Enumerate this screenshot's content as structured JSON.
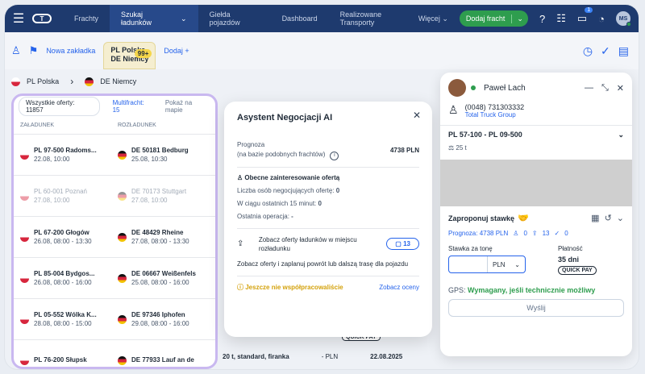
{
  "nav": {
    "logo": "T",
    "items": [
      "Frachty",
      "Szukaj ładunków",
      "Giełda pojazdów",
      "Dashboard",
      "Realizowane Transporty"
    ],
    "more": "Więcej",
    "add_freight": "Dodaj fracht",
    "chat_badge": "1",
    "avatar": "MS"
  },
  "tabs": {
    "new_tab": "Nowa zakładka",
    "active_tab_line1": "PL Polska",
    "active_tab_line2": "DE Niemcy",
    "active_tab_badge": "99+",
    "add": "Dodaj +"
  },
  "route": {
    "from": "PL Polska",
    "to": "DE Niemcy"
  },
  "filters": {
    "all": "Wszystkie oferty: 11857",
    "multifreight": "Multifracht: 15",
    "map": "Pokaż na mapie"
  },
  "columns": {
    "loading": "ZAŁADUNEK",
    "unloading": "ROZŁADUNEK"
  },
  "rows": [
    {
      "from": "PL 97-500 Radoms...",
      "from_date": "22.08, 10:00",
      "to": "DE 50181 Bedburg",
      "to_date": "25.08, 10:30",
      "faded": false
    },
    {
      "from": "PL 60-001 Poznań",
      "from_date": "27.08, 10:00",
      "to": "DE 70173 Stuttgart",
      "to_date": "27.08, 10:00",
      "faded": true
    },
    {
      "from": "PL 67-200 Głogów",
      "from_date": "26.08, 08:00 - 13:30",
      "to": "DE 48429 Rheine",
      "to_date": "27.08, 08:00 - 13:30",
      "faded": false
    },
    {
      "from": "PL 85-004 Bydgos...",
      "from_date": "26.08, 08:00 - 16:00",
      "to": "DE 06667 Weißenfels",
      "to_date": "25.08, 08:00 - 16:00",
      "faded": false
    },
    {
      "from": "PL 05-552 Wólka K...",
      "from_date": "28.08, 08:00 - 15:00",
      "to": "DE 97346 Iphofen",
      "to_date": "29.08, 08:00 - 16:00",
      "faded": false
    },
    {
      "from": "PL 76-200 Słupsk",
      "from_date": "",
      "to": "DE 77933 Lauf an de",
      "to_date": "",
      "faded": false
    }
  ],
  "background": {
    "cargo": "20 t, standard, firanka",
    "price": "- PLN",
    "date": "22.08.2025",
    "quick": "QUICK PAY"
  },
  "ai": {
    "title": "Asystent Negocjacji AI",
    "forecast_label": "Prognoza",
    "forecast_sub": "(na bazie podobnych frachtów)",
    "forecast_value": "4738 PLN",
    "interest_title": "Obecne zainteresowanie ofertą",
    "negotiating": "Liczba osób negocjujących ofertę: ",
    "negotiating_val": "0",
    "last15": "W ciągu ostatnich 15 minut: ",
    "last15_val": "0",
    "last_op": "Ostatnia operacja: ",
    "last_op_val": "-",
    "offers_label": "Zobacz oferty ładunków w miejscu rozładunku",
    "offers_count": "13",
    "offers_desc": "Zobacz oferty i zaplanuj powrót lub dalszą trasę dla pojazdu",
    "warn": "Jeszcze nie współpracowaliście",
    "ratings": "Zobacz oceny"
  },
  "panel": {
    "name": "Paweł Lach",
    "phone": "(0048) 731303332",
    "company": "Total Truck Group",
    "route": "PL 57-100 - PL 09-500",
    "weight": "25 t",
    "propose": "Zaproponuj stawkę",
    "forecast": "Prognoza: 4738 PLN",
    "s1": "0",
    "s2": "13",
    "s3": "0",
    "rate_label": "Stawka za tonę",
    "currency": "PLN",
    "payment_label": "Płatność",
    "payment_days": "35 dni",
    "quick": "QUICK PAY",
    "gps_label": "GPS: ",
    "gps_value": "Wymagany, jeśli technicznie możliwy",
    "send": "Wyślij"
  },
  "colors": {
    "nav": "#1e3a6e",
    "accent": "#2563eb",
    "green": "#2e9d4e",
    "warn": "#d4a20c",
    "highlight": "#c9b8f0"
  }
}
